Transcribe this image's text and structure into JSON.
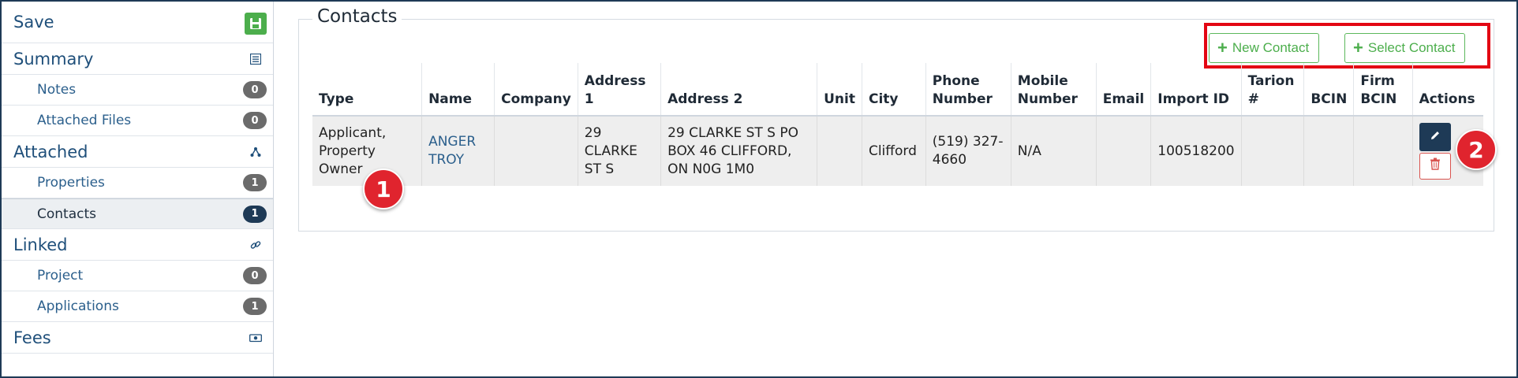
{
  "sidebar": {
    "save": {
      "label": "Save",
      "icon": "floppy-disk-icon"
    },
    "summary": {
      "label": "Summary",
      "icon": "list-icon"
    },
    "notes": {
      "label": "Notes",
      "count": "0"
    },
    "attached_files": {
      "label": "Attached Files",
      "count": "0"
    },
    "attached": {
      "label": "Attached",
      "icon": "sitemap-icon"
    },
    "properties": {
      "label": "Properties",
      "count": "1"
    },
    "contacts": {
      "label": "Contacts",
      "count": "1"
    },
    "linked": {
      "label": "Linked",
      "icon": "link-icon"
    },
    "project": {
      "label": "Project",
      "count": "0"
    },
    "applications": {
      "label": "Applications",
      "count": "1"
    },
    "fees": {
      "label": "Fees",
      "icon": "money-icon"
    }
  },
  "main": {
    "section_title": "Contacts",
    "new_contact_label": "New Contact",
    "select_contact_label": "Select Contact",
    "table": {
      "headers": [
        "Type",
        "Name",
        "Company",
        "Address 1",
        "Address 2",
        "Unit",
        "City",
        "Phone Number",
        "Mobile Number",
        "Email",
        "Import ID",
        "Tarion #",
        "BCIN",
        "Firm BCIN",
        "Actions"
      ],
      "rows": [
        {
          "type": "Applicant, Property Owner",
          "name": "ANGER TROY",
          "company": "",
          "address1": "29 CLARKE ST S",
          "address2": "29 CLARKE ST S PO BOX 46 CLIFFORD, ON N0G 1M0",
          "unit": "",
          "city": "Clifford",
          "phone": "(519) 327-4660",
          "mobile": "N/A",
          "email": "",
          "import_id": "100518200",
          "tarion": "",
          "bcin": "",
          "firm_bcin": ""
        }
      ]
    }
  },
  "annotations": {
    "marker1": "1",
    "marker2": "2"
  },
  "colors": {
    "accent": "#1e3a56",
    "success": "#5cb85c",
    "danger": "#d9534f",
    "highlight": "#e30613"
  }
}
